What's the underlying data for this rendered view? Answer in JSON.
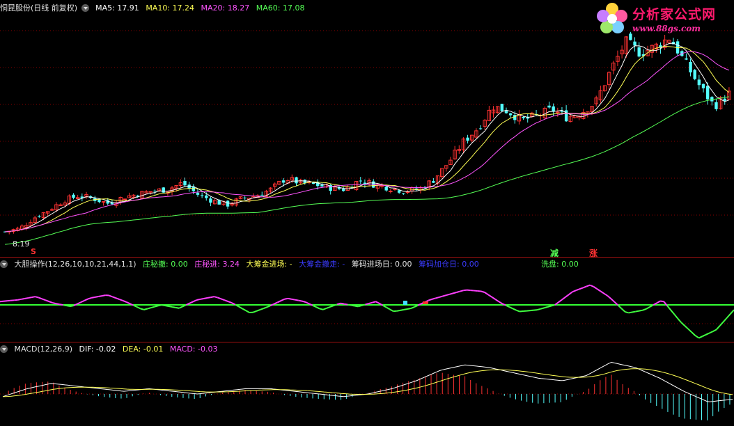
{
  "main_header": {
    "title": "恫昆股份(日线 前复权)",
    "ma5": "MA5: 17.91",
    "ma10": "MA10: 17.24",
    "ma20": "MA20: 18.27",
    "ma60": "MA60: 17.08"
  },
  "indicator_header": {
    "name": "大胆操作(12,26,10,10,21,44,1,1)",
    "zhuang_absorb": "庄秘撤: 0.00",
    "zhuang_enter": "庄秘进: 3.24",
    "big_fund_in": "大筹金进场: -",
    "big_fund_out": "大筹金撤走: -",
    "chip_entry_day": "筹码进场日: 0.00",
    "chip_add_day": "筹码加仓日: 0.00",
    "wash": "洗盘: 0.00"
  },
  "macd_header": {
    "name": "MACD(12,26,9)",
    "dif": "DIF: -0.02",
    "dea": "DEA: -0.01",
    "macd": "MACD: -0.03"
  },
  "low_label": "8.19",
  "markers": {
    "s": "S",
    "jian": "减",
    "zhang": "涨"
  },
  "logo": {
    "title": "分析家公式网",
    "url": "www.88gs.com"
  },
  "colors": {
    "up": "#ff3232",
    "down": "#54ffff",
    "ma5": "#ffffff",
    "ma10": "#ffff55",
    "ma20": "#ff55ff",
    "ma60": "#55ff55",
    "grid": "#8b0000"
  },
  "chart_data": {
    "type": "candlestick",
    "price_anchor": {
      "low": 8.19
    },
    "close_trend": [
      9.2,
      9.4,
      10.1,
      10.6,
      11.2,
      11.5,
      11.3,
      11.0,
      11.4,
      11.6,
      11.8,
      11.9,
      12.3,
      11.6,
      11.2,
      10.9,
      11.3,
      11.5,
      11.9,
      12.6,
      12.3,
      12.2,
      12.0,
      11.9,
      12.5,
      12.2,
      12.0,
      11.8,
      11.9,
      12.5,
      13.6,
      14.9,
      15.8,
      17.2,
      16.9,
      16.3,
      16.6,
      17.0,
      16.5,
      16.8,
      17.5,
      19.5,
      21.3,
      20.6,
      21.0,
      21.6,
      20.0,
      18.5,
      17.2,
      18.0
    ],
    "indicator_line": [
      0.2,
      0.3,
      0.5,
      0.1,
      -0.1,
      0.4,
      0.6,
      0.2,
      -0.3,
      0.0,
      -0.2,
      0.3,
      0.5,
      0.1,
      -0.5,
      -0.1,
      0.4,
      0.2,
      -0.3,
      0.1,
      -0.1,
      0.2,
      -0.4,
      -0.2,
      0.3,
      0.6,
      0.9,
      0.8,
      0.1,
      -0.4,
      -0.3,
      0.0,
      0.8,
      1.2,
      0.5,
      -0.5,
      -0.3,
      0.3,
      -1.0,
      -2.0,
      -1.5,
      -0.3
    ],
    "macd_dif_trend": [
      -0.1,
      0.2,
      0.4,
      0.3,
      0.2,
      0.1,
      0.2,
      0.1,
      0.0,
      0.1,
      0.2,
      0.2,
      0.1,
      0.0,
      -0.1,
      0.0,
      0.2,
      0.5,
      0.9,
      1.1,
      1.0,
      0.8,
      0.6,
      0.5,
      0.7,
      1.2,
      1.0,
      0.6,
      0.1,
      -0.3,
      -0.2
    ]
  }
}
